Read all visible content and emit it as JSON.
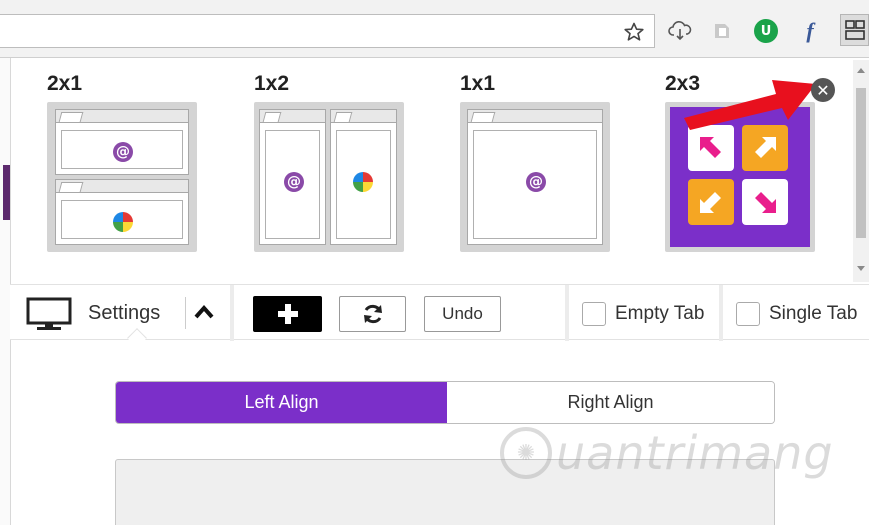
{
  "toolbar": {
    "extension_green_label": "U",
    "extension_f_label": "f"
  },
  "layouts": [
    {
      "label": "2x1"
    },
    {
      "label": "1x2"
    },
    {
      "label": "1x1"
    },
    {
      "label": "2x3"
    }
  ],
  "colors": {
    "accent_purple": "#7b2fc9",
    "quadrant_pink": "#e91e8c",
    "quadrant_orange": "#f5a623",
    "arrow_red": "#e8101e"
  },
  "controls": {
    "settings_label": "Settings",
    "undo_label": "Undo",
    "empty_tab_label": "Empty Tab",
    "single_tab_label": "Single Tab"
  },
  "align": {
    "left_label": "Left Align",
    "right_label": "Right Align",
    "selected": "Left Align"
  },
  "watermark": {
    "text": "uantrimang"
  }
}
